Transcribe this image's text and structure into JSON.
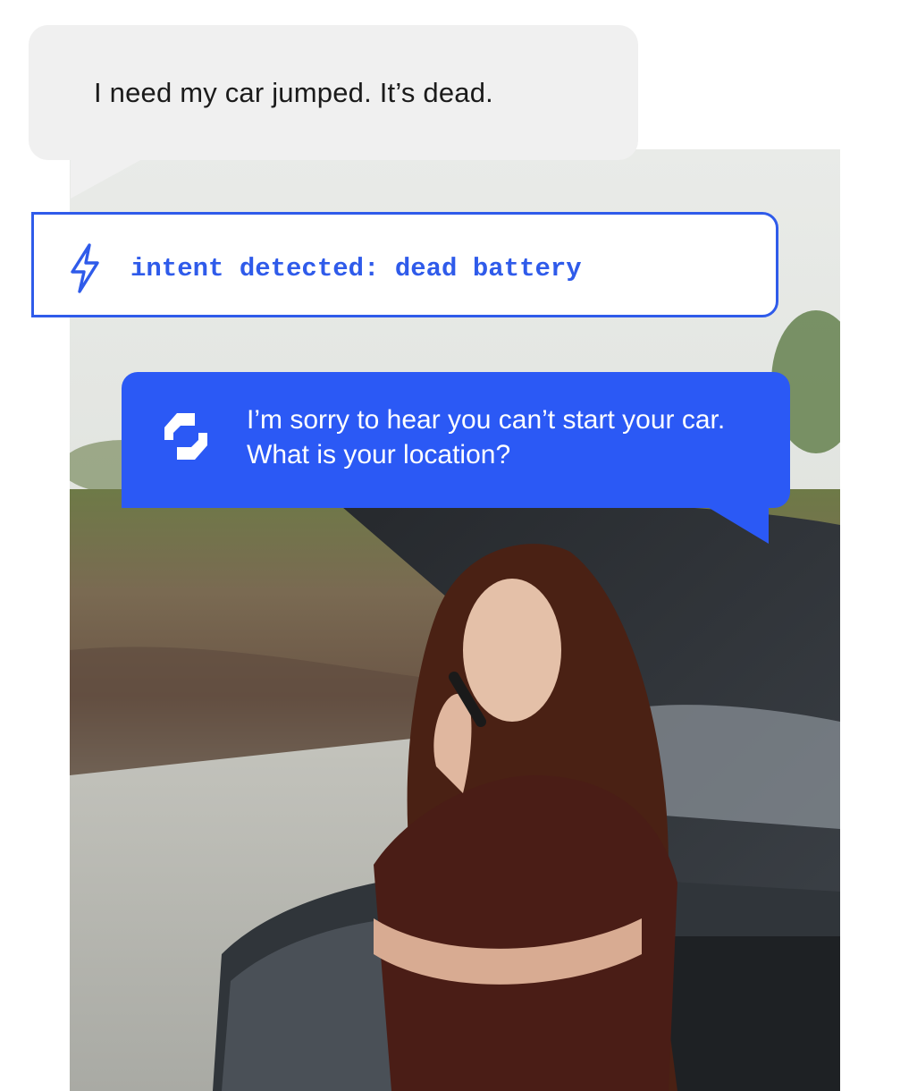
{
  "photo": {
    "subject": "person-on-phone-photo",
    "sky_color": "#dfe3e0",
    "field_color": "#7b7a4a",
    "road_color": "#b8b8b2",
    "hair_color": "#4a2114",
    "shirt_color": "#4a1d16",
    "car_color": "#2c3136"
  },
  "conversation": {
    "user_message": "I need my car jumped. It’s dead.",
    "intent": {
      "icon": "lightning-icon",
      "text": "intent detected: dead battery",
      "accent_color": "#2f5bea"
    },
    "bot_message": {
      "icon": "brand-logo-icon",
      "text": "I’m sorry to hear you can’t start your car. What is your location?",
      "bubble_color": "#2b59f5"
    }
  }
}
